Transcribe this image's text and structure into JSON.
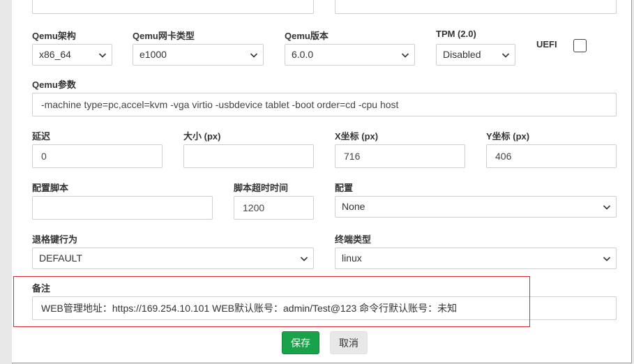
{
  "fields": {
    "qemu_arch": {
      "label": "Qemu架构",
      "value": "x86_64"
    },
    "nic_type": {
      "label": "Qemu网卡类型",
      "value": "e1000"
    },
    "qemu_version": {
      "label": "Qemu版本",
      "value": "6.0.0"
    },
    "tpm": {
      "label": "TPM (2.0)",
      "value": "Disabled"
    },
    "uefi": {
      "label": "UEFI",
      "checked": false
    },
    "qemu_params": {
      "label": "Qemu参数",
      "value": "-machine type=pc,accel=kvm -vga virtio -usbdevice tablet -boot order=cd -cpu host"
    },
    "delay": {
      "label": "延迟",
      "value": "0"
    },
    "size": {
      "label": "大小 (px)",
      "value": ""
    },
    "x_coord": {
      "label": "X坐标 (px)",
      "value": "716"
    },
    "y_coord": {
      "label": "Y坐标 (px)",
      "value": "406"
    },
    "config_script": {
      "label": "配置脚本",
      "value": ""
    },
    "script_timeout": {
      "label": "脚本超时时间",
      "value": "1200"
    },
    "config": {
      "label": "配置",
      "value": "None"
    },
    "backspace": {
      "label": "退格键行为",
      "value": "DEFAULT"
    },
    "terminal_type": {
      "label": "终端类型",
      "value": "linux"
    },
    "notes": {
      "label": "备注",
      "value": "WEB管理地址：https://169.254.10.101 WEB默认账号：admin/Test@123 命令行默认账号：未知"
    }
  },
  "buttons": {
    "save": "保存",
    "cancel": "取消"
  },
  "colors": {
    "save_bg": "#1aa24a",
    "highlight_border": "#d7282f"
  },
  "icons": {
    "select_arrow": "chevron-down-icon"
  }
}
